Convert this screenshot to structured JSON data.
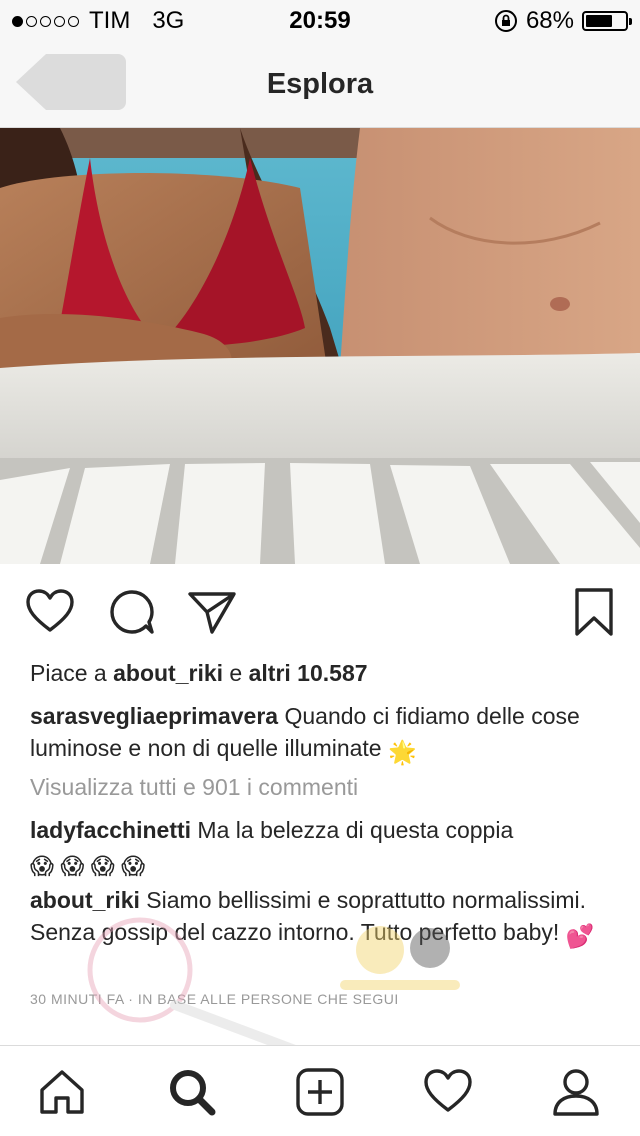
{
  "status_bar": {
    "carrier": "TIM",
    "network": "3G",
    "time": "20:59",
    "battery_percent": "68%",
    "battery_level": 0.68,
    "signal_bars": 1,
    "signal_total": 5
  },
  "nav": {
    "title": "Esplora",
    "back_icon": "back-arrow-icon"
  },
  "post": {
    "likes_prefix": "Piace a ",
    "likes_user": "about_riki",
    "likes_mid": " e ",
    "likes_count": "altri 10.587",
    "caption_user": "sarasvegliaeprimavera",
    "caption_text": " Quando ci fidiamo delle cose luminose e non di quelle illuminate ",
    "caption_emoji": "🌟",
    "view_all": "Visualizza tutti e 901 i commenti",
    "comments": [
      {
        "user": "ladyfacchinetti",
        "text": " Ma la belezza di questa coppia",
        "emoji": "😱 😱 😱 😱"
      },
      {
        "user": "about_riki",
        "text": " Siamo bellissimi e soprattutto normalissimi. Senza gossip del cazzo intorno. Tutto perfetto baby! ",
        "emoji": "💕"
      }
    ],
    "timestamp": "30 MINUTI FA · IN BASE ALLE PERSONE CHE SEGUI"
  },
  "actions": [
    "heart-icon",
    "comment-icon",
    "share-icon",
    "bookmark-icon"
  ],
  "tab_bar": [
    "home-icon",
    "search-icon",
    "add-icon",
    "activity-icon",
    "profile-icon"
  ],
  "colors": {
    "bikini": "#b5172d",
    "pool": "#3aa8c8",
    "text": "#262626",
    "muted": "#999999"
  }
}
